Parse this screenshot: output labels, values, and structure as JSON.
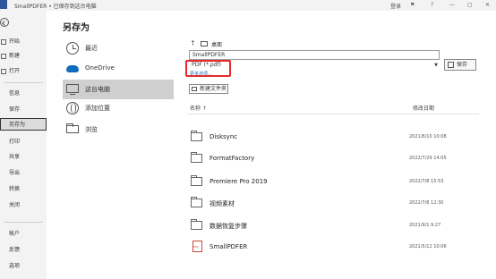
{
  "titlebar": {
    "title": "SmallPDFER • 已保存到这台电脑",
    "user": "登录",
    "help": "?",
    "minimize": "—",
    "maximize": "▢",
    "close": "✕"
  },
  "sidebar": {
    "items": [
      {
        "label": "开始",
        "icon": "home-icon"
      },
      {
        "label": "新建",
        "icon": "new-icon"
      },
      {
        "label": "打开",
        "icon": "open-icon"
      },
      {
        "label": "信息"
      },
      {
        "label": "保存"
      },
      {
        "label": "另存为"
      },
      {
        "label": "打印"
      },
      {
        "label": "共享"
      },
      {
        "label": "导出"
      },
      {
        "label": "转换"
      },
      {
        "label": "关闭"
      },
      {
        "label": "帐户"
      },
      {
        "label": "反馈"
      },
      {
        "label": "选项"
      }
    ],
    "active": "另存为"
  },
  "main": {
    "heading": "另存为",
    "locations": [
      {
        "label": "最近",
        "icon": "clock-icon"
      },
      {
        "label": "OneDrive",
        "icon": "cloud-icon"
      },
      {
        "label": "这台电脑",
        "icon": "pc-icon",
        "selected": true
      },
      {
        "label": "添加位置",
        "icon": "globe-icon"
      },
      {
        "label": "浏览",
        "icon": "folder-icon"
      }
    ]
  },
  "browser": {
    "breadcrumb": "桌面",
    "filename": "SmallPDFER",
    "filetype": "PDF (*.pdf)",
    "more_options": "更多选项...",
    "save_label": "保存",
    "new_folder_label": "新建文件夹",
    "col_name": "名称 ↑",
    "col_date": "修改日期",
    "rows": [
      {
        "name": "Disksync",
        "date": "2021/8/10 10:08",
        "type": "folder"
      },
      {
        "name": "FormatFactory",
        "date": "2022/7/29 14:05",
        "type": "folder"
      },
      {
        "name": "Premiere Pro 2019",
        "date": "2022/7/8 15:53",
        "type": "folder"
      },
      {
        "name": "视频素材",
        "date": "2022/7/8 12:30",
        "type": "folder"
      },
      {
        "name": "数据恢复步骤",
        "date": "2021/9/1 9:27",
        "type": "folder"
      },
      {
        "name": "SmallPDFER",
        "date": "2021/5/12 10:06",
        "type": "pdf"
      }
    ]
  },
  "colors": {
    "accent": "#2b579a",
    "highlight": "#e52b2b",
    "link": "#1c62b9",
    "onedrive": "#0f6cbd"
  }
}
